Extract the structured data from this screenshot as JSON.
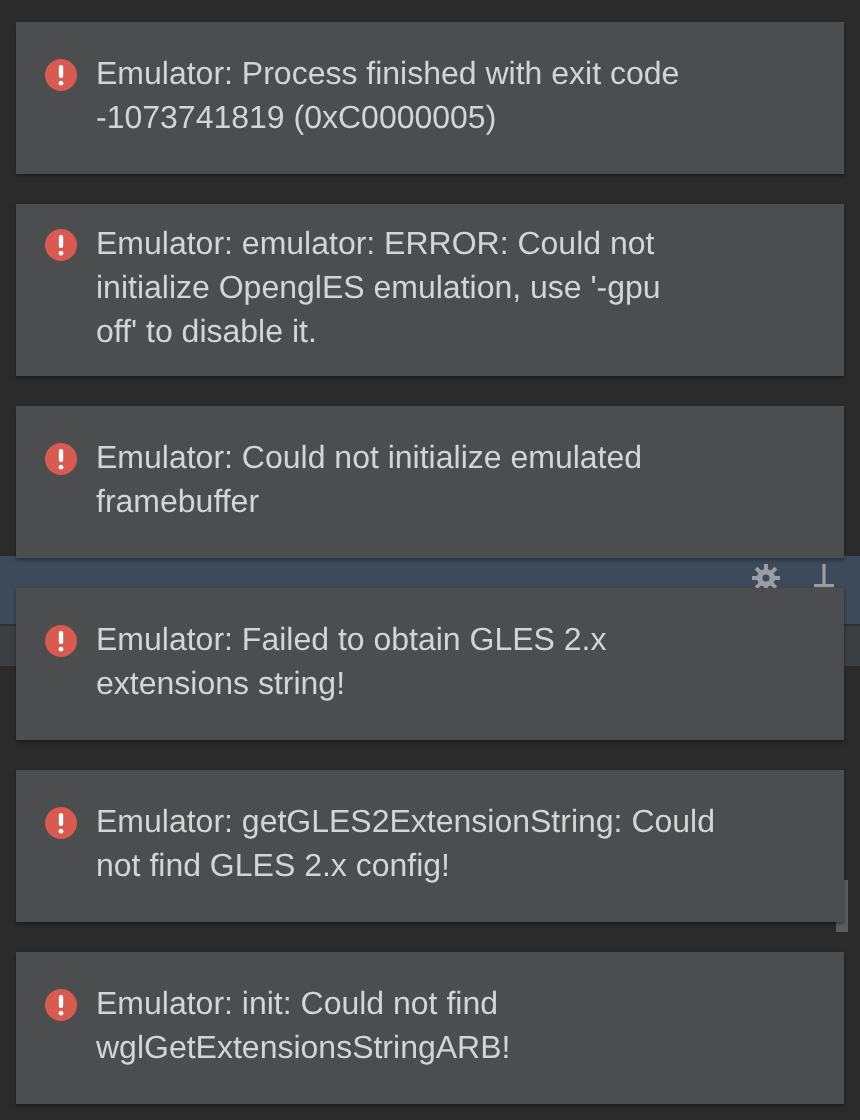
{
  "notifications": [
    {
      "kind": "error",
      "lines": [
        "Emulator: Process finished with exit code",
        "-1073741819 (0xC0000005)"
      ]
    },
    {
      "kind": "error",
      "lines": [
        "Emulator: emulator: ERROR: Could not",
        "initialize OpenglES emulation, use '-gpu",
        "off' to disable it."
      ]
    },
    {
      "kind": "error",
      "lines": [
        "Emulator: Could not initialize emulated",
        "framebuffer"
      ]
    },
    {
      "kind": "error",
      "lines": [
        "Emulator: Failed to obtain GLES 2.x",
        "extensions string!"
      ]
    },
    {
      "kind": "error",
      "lines": [
        "Emulator: getGLES2ExtensionString: Could",
        "not find GLES 2.x config!"
      ]
    },
    {
      "kind": "error",
      "lines": [
        "Emulator: init: Could not find",
        "wglGetExtensionsStringARB!"
      ]
    }
  ]
}
